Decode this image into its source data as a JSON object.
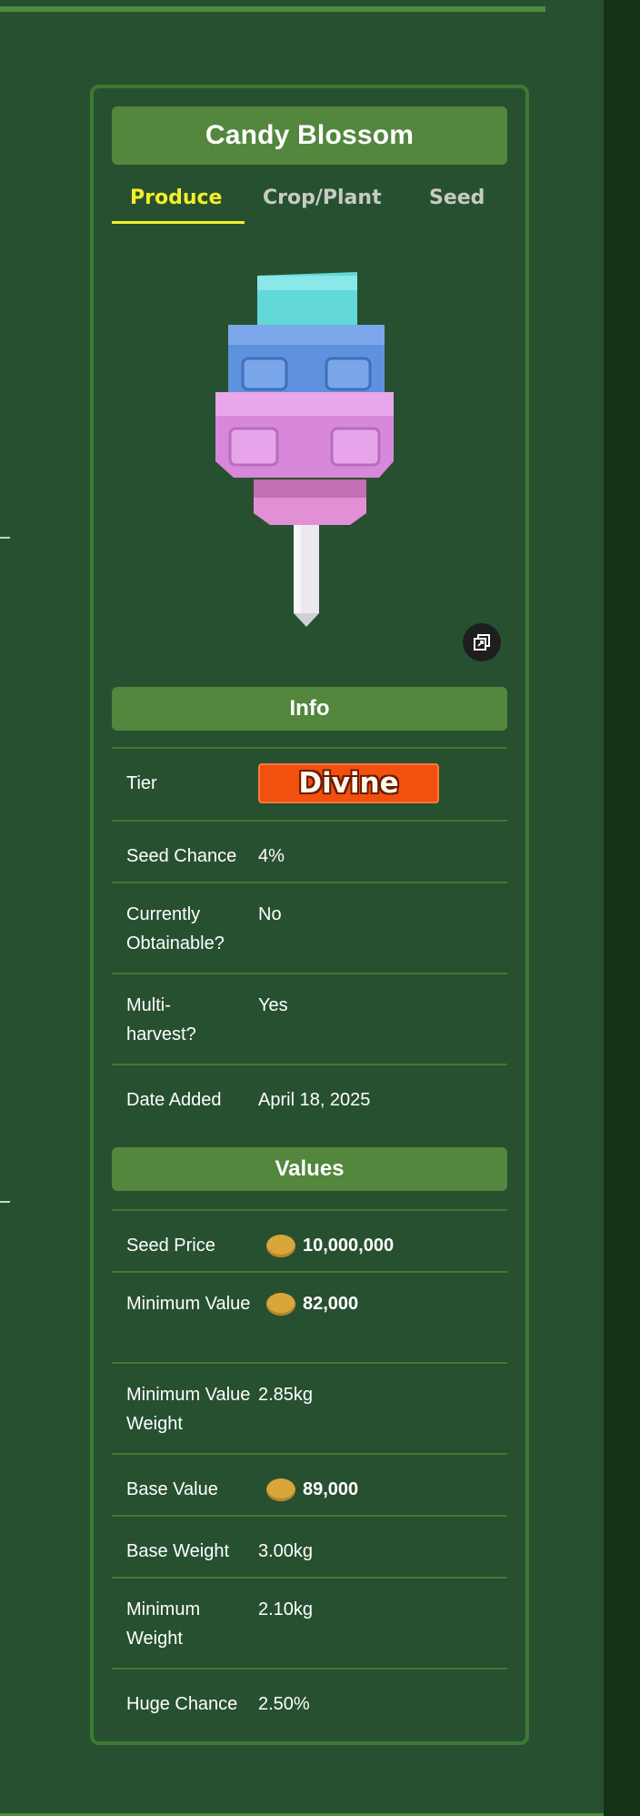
{
  "page": {
    "title": "Candy Blossom",
    "tabs": [
      {
        "label": "Produce",
        "active": true
      },
      {
        "label": "Crop/Plant",
        "active": false
      },
      {
        "label": "Seed",
        "active": false
      }
    ],
    "image_alt": "Candy Blossom produce render",
    "expand_icon": "expand-icon"
  },
  "info": {
    "heading": "Info",
    "rows": [
      {
        "label": "Tier",
        "value": "Divine"
      },
      {
        "label": "Seed Chance",
        "value": "4%"
      },
      {
        "label": "Currently Obtainable?",
        "value": "No"
      },
      {
        "label": "Multi-harvest?",
        "value": "Yes"
      },
      {
        "label": "Date Added",
        "value": "April 18, 2025"
      }
    ]
  },
  "values": {
    "heading": "Values",
    "rows": [
      {
        "label": "Seed Price",
        "value": "10,000,000"
      },
      {
        "label": "Minimum Value",
        "value": "82,000"
      },
      {
        "label": "Minimum Value Weight",
        "value": "2.85kg"
      },
      {
        "label": "Base Value",
        "value": "89,000"
      },
      {
        "label": "Base Weight",
        "value": "3.00kg"
      },
      {
        "label": "Minimum Weight",
        "value": "2.10kg"
      },
      {
        "label": "Huge Chance",
        "value": "2.50%"
      }
    ]
  },
  "colors": {
    "background": "#275030",
    "accent_green": "#52873d",
    "tab_active": "#f4ef2c",
    "tier_divine": "#f2500e",
    "coin": "#d9a63a"
  }
}
